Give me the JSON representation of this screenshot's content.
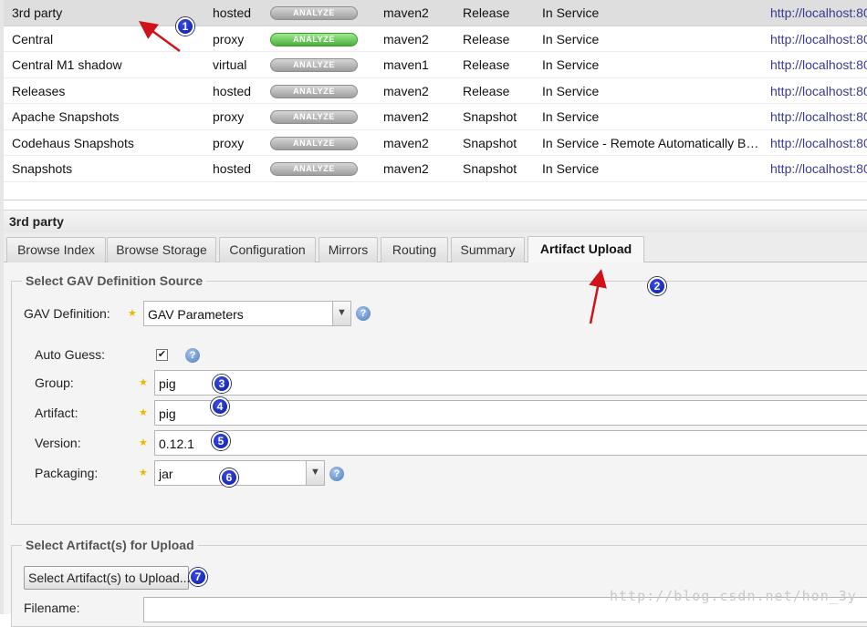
{
  "repositories": [
    {
      "name": "3rd party",
      "type": "hosted",
      "analyze_label": "ANALYZE",
      "analyze_state": "disabled",
      "format": "maven2",
      "policy": "Release",
      "status": "In Service",
      "url": "http://localhost:80"
    },
    {
      "name": "Central",
      "type": "proxy",
      "analyze_label": "ANALYZE",
      "analyze_state": "enabled",
      "format": "maven2",
      "policy": "Release",
      "status": "In Service",
      "url": "http://localhost:80"
    },
    {
      "name": "Central M1 shadow",
      "type": "virtual",
      "analyze_label": "ANALYZE",
      "analyze_state": "disabled",
      "format": "maven1",
      "policy": "Release",
      "status": "In Service",
      "url": "http://localhost:80"
    },
    {
      "name": "Releases",
      "type": "hosted",
      "analyze_label": "ANALYZE",
      "analyze_state": "disabled",
      "format": "maven2",
      "policy": "Release",
      "status": "In Service",
      "url": "http://localhost:80"
    },
    {
      "name": "Apache Snapshots",
      "type": "proxy",
      "analyze_label": "ANALYZE",
      "analyze_state": "disabled",
      "format": "maven2",
      "policy": "Snapshot",
      "status": "In Service",
      "url": "http://localhost:80"
    },
    {
      "name": "Codehaus Snapshots",
      "type": "proxy",
      "analyze_label": "ANALYZE",
      "analyze_state": "disabled",
      "format": "maven2",
      "policy": "Snapshot",
      "status": "In Service - Remote Automatically Bl…",
      "url": "http://localhost:80"
    },
    {
      "name": "Snapshots",
      "type": "hosted",
      "analyze_label": "ANALYZE",
      "analyze_state": "disabled",
      "format": "maven2",
      "policy": "Snapshot",
      "status": "In Service",
      "url": "http://localhost:80"
    }
  ],
  "selected_repository": "3rd party",
  "panel": {
    "title": "3rd party",
    "tabs": [
      {
        "label": "Browse Index",
        "active": false
      },
      {
        "label": "Browse Storage",
        "active": false
      },
      {
        "label": "Configuration",
        "active": false
      },
      {
        "label": "Mirrors",
        "active": false
      },
      {
        "label": "Routing",
        "active": false
      },
      {
        "label": "Summary",
        "active": false
      },
      {
        "label": "Artifact Upload",
        "active": true
      }
    ]
  },
  "gav_section": {
    "legend": "Select GAV Definition Source",
    "gav_definition_label": "GAV Definition:",
    "gav_definition_value": "GAV Parameters",
    "auto_guess_label": "Auto Guess:",
    "auto_guess_checked": true,
    "group_label": "Group:",
    "group_value": "pig",
    "artifact_label": "Artifact:",
    "artifact_value": "pig",
    "version_label": "Version:",
    "version_value": "0.12.1",
    "packaging_label": "Packaging:",
    "packaging_value": "jar"
  },
  "upload_section": {
    "legend": "Select Artifact(s) for Upload",
    "button_label": "Select Artifact(s) to Upload...",
    "filename_label": "Filename:",
    "filename_value": ""
  },
  "annotations": [
    "1",
    "2",
    "3",
    "4",
    "5",
    "6",
    "7"
  ],
  "watermark": "http://blog.csdn.net/hon_3y",
  "icons": {
    "help": "help-icon",
    "star": "required-star-icon",
    "dropdown": "chevron-down-icon"
  },
  "colors": {
    "analyze_enabled": "#4db03a",
    "analyze_disabled": "#9e9e9e",
    "required_star": "#f1b400",
    "annotation_badge": "#0a1aa8",
    "annotation_arrow": "#d0121b"
  }
}
